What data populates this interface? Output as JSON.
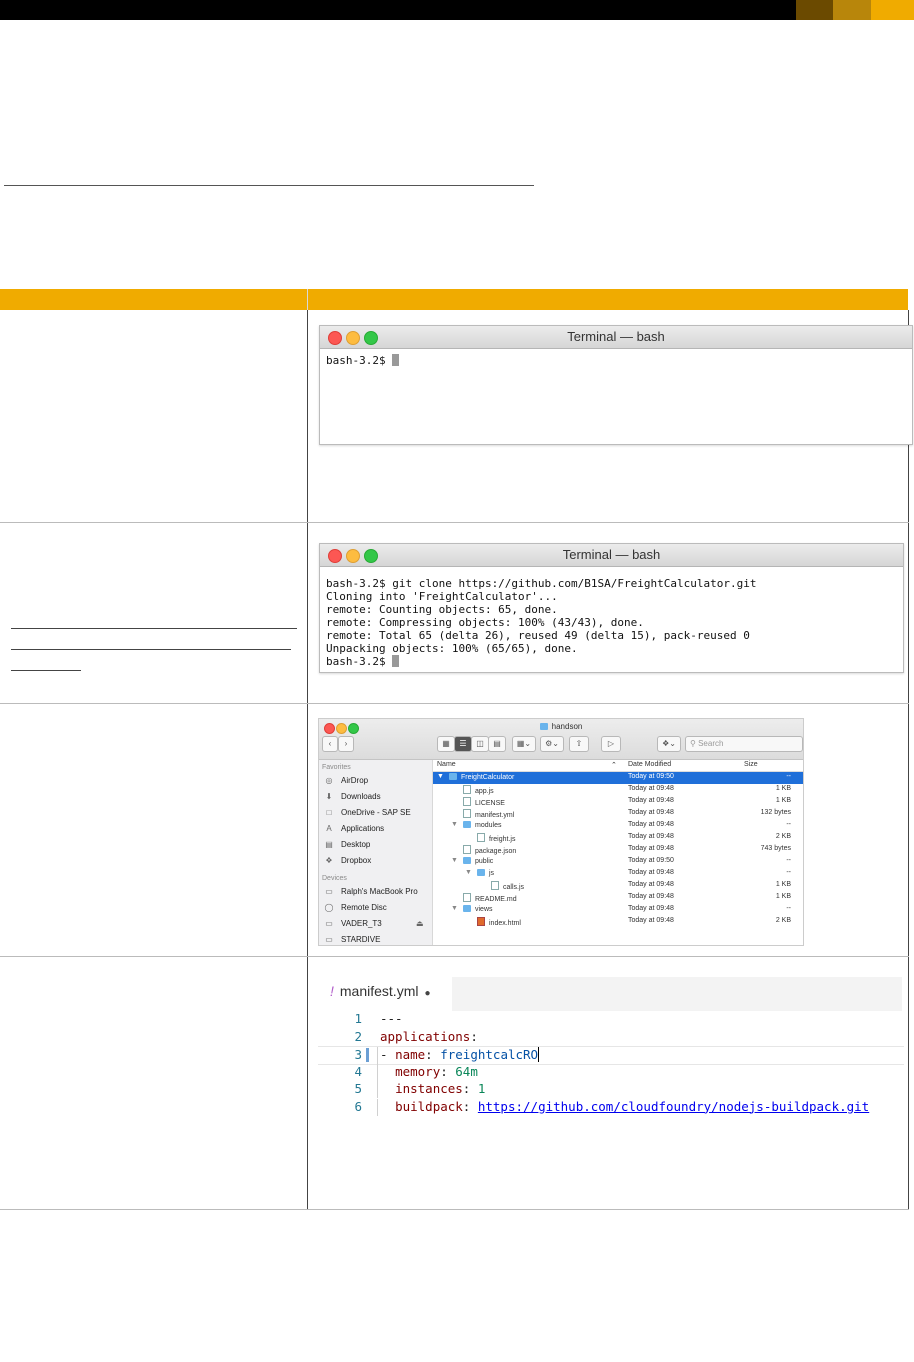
{
  "header_colors": {
    "bar": "#000000",
    "swatches": [
      "#6b4a00",
      "#b8860b",
      "#f0ab00"
    ]
  },
  "table": {
    "header_color": "#f0ab00"
  },
  "terminal1": {
    "title": "Terminal — bash",
    "lines": [
      "bash-3.2$ "
    ]
  },
  "terminal2": {
    "title": "Terminal — bash",
    "lines": [
      "bash-3.2$ git clone https://github.com/B1SA/FreightCalculator.git",
      "Cloning into 'FreightCalculator'...",
      "remote: Counting objects: 65, done.",
      "remote: Compressing objects: 100% (43/43), done.",
      "remote: Total 65 (delta 26), reused 49 (delta 15), pack-reused 0",
      "Unpacking objects: 100% (65/65), done.",
      "bash-3.2$ "
    ]
  },
  "finder": {
    "title": "handson",
    "search_placeholder": "Search",
    "sidebar": {
      "favorites_header": "Favorites",
      "favorites": [
        "AirDrop",
        "Downloads",
        "OneDrive - SAP SE",
        "Applications",
        "Desktop",
        "Dropbox"
      ],
      "devices_header": "Devices",
      "devices": [
        "Ralph's MacBook Pro",
        "Remote Disc",
        "VADER_T3",
        "STARDIVE"
      ]
    },
    "columns": {
      "name": "Name",
      "date": "Date Modified",
      "size": "Size"
    },
    "rows": [
      {
        "name": "FreightCalculator",
        "date": "Today at 09:50",
        "size": "--"
      },
      {
        "name": "app.js",
        "date": "Today at 09:48",
        "size": "1 KB"
      },
      {
        "name": "LICENSE",
        "date": "Today at 09:48",
        "size": "1 KB"
      },
      {
        "name": "manifest.yml",
        "date": "Today at 09:48",
        "size": "132 bytes"
      },
      {
        "name": "modules",
        "date": "Today at 09:48",
        "size": "--"
      },
      {
        "name": "freight.js",
        "date": "Today at 09:48",
        "size": "2 KB"
      },
      {
        "name": "package.json",
        "date": "Today at 09:48",
        "size": "743 bytes"
      },
      {
        "name": "public",
        "date": "Today at 09:50",
        "size": "--"
      },
      {
        "name": "js",
        "date": "Today at 09:48",
        "size": "--"
      },
      {
        "name": "calls.js",
        "date": "Today at 09:48",
        "size": "1 KB"
      },
      {
        "name": "README.md",
        "date": "Today at 09:48",
        "size": "1 KB"
      },
      {
        "name": "views",
        "date": "Today at 09:48",
        "size": "--"
      },
      {
        "name": "index.html",
        "date": "Today at 09:48",
        "size": "2 KB"
      }
    ]
  },
  "editor": {
    "tab_icon": "!",
    "tab_name": "manifest.yml",
    "modified_marker": "●",
    "lines": [
      {
        "num": "1",
        "parts": [
          [
            "",
            "---"
          ]
        ]
      },
      {
        "num": "2",
        "parts": [
          [
            "k",
            "applications"
          ],
          [
            "",
            ":"
          ]
        ]
      },
      {
        "num": "3",
        "parts": [
          [
            "",
            "- "
          ],
          [
            "k",
            "name"
          ],
          [
            "",
            ": "
          ],
          [
            "s",
            "freightcalcRO"
          ]
        ]
      },
      {
        "num": "4",
        "parts": [
          [
            "",
            "  "
          ],
          [
            "k",
            "memory"
          ],
          [
            "",
            ": "
          ],
          [
            "n",
            "64m"
          ]
        ]
      },
      {
        "num": "5",
        "parts": [
          [
            "",
            "  "
          ],
          [
            "k",
            "instances"
          ],
          [
            "",
            ": "
          ],
          [
            "n",
            "1"
          ]
        ]
      },
      {
        "num": "6",
        "parts": [
          [
            "",
            "  "
          ],
          [
            "k",
            "buildpack"
          ],
          [
            "",
            ": "
          ],
          [
            "u",
            "https://github.com/cloudfoundry/nodejs-buildpack.git"
          ]
        ]
      }
    ]
  }
}
